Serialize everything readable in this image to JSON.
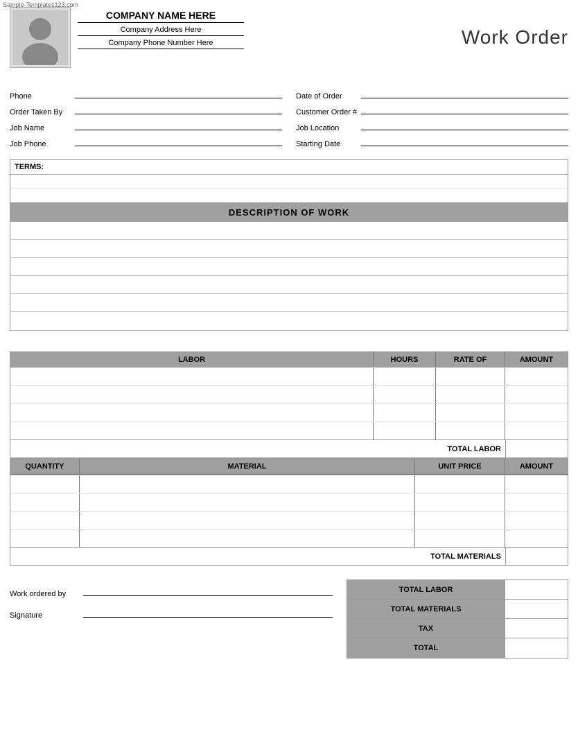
{
  "watermark": "Sample-Templates123.com",
  "header": {
    "company_name": "COMPANY NAME HERE",
    "company_address": "Company Address Here",
    "company_phone": "Company Phone Number Here",
    "title": "Work Order"
  },
  "fields": {
    "phone_label": "Phone",
    "date_of_order_label": "Date of Order",
    "order_taken_by_label": "Order Taken By",
    "customer_order_label": "Customer Order #",
    "job_name_label": "Job Name",
    "job_location_label": "Job Location",
    "job_phone_label": "Job Phone",
    "starting_date_label": "Starting Date"
  },
  "terms": {
    "label": "TERMS:"
  },
  "description": {
    "header": "DESCRIPTION OF WORK",
    "rows": 6
  },
  "labor": {
    "col_labor": "LABOR",
    "col_hours": "HOURS",
    "col_rate": "RATE OF",
    "col_amount": "AMOUNT",
    "rows": 4,
    "total_label": "TOTAL LABOR"
  },
  "materials": {
    "col_quantity": "QUANTITY",
    "col_material": "MATERIAL",
    "col_unit_price": "UNIT PRICE",
    "col_amount": "AMOUNT",
    "rows": 4,
    "total_label": "TOTAL MATERIALS"
  },
  "summary": {
    "work_ordered_by_label": "Work ordered by",
    "signature_label": "Signature",
    "totals": [
      {
        "label": "TOTAL LABOR"
      },
      {
        "label": "TOTAL MATERIALS"
      },
      {
        "label": "TAX"
      },
      {
        "label": "TOTAL"
      }
    ]
  }
}
